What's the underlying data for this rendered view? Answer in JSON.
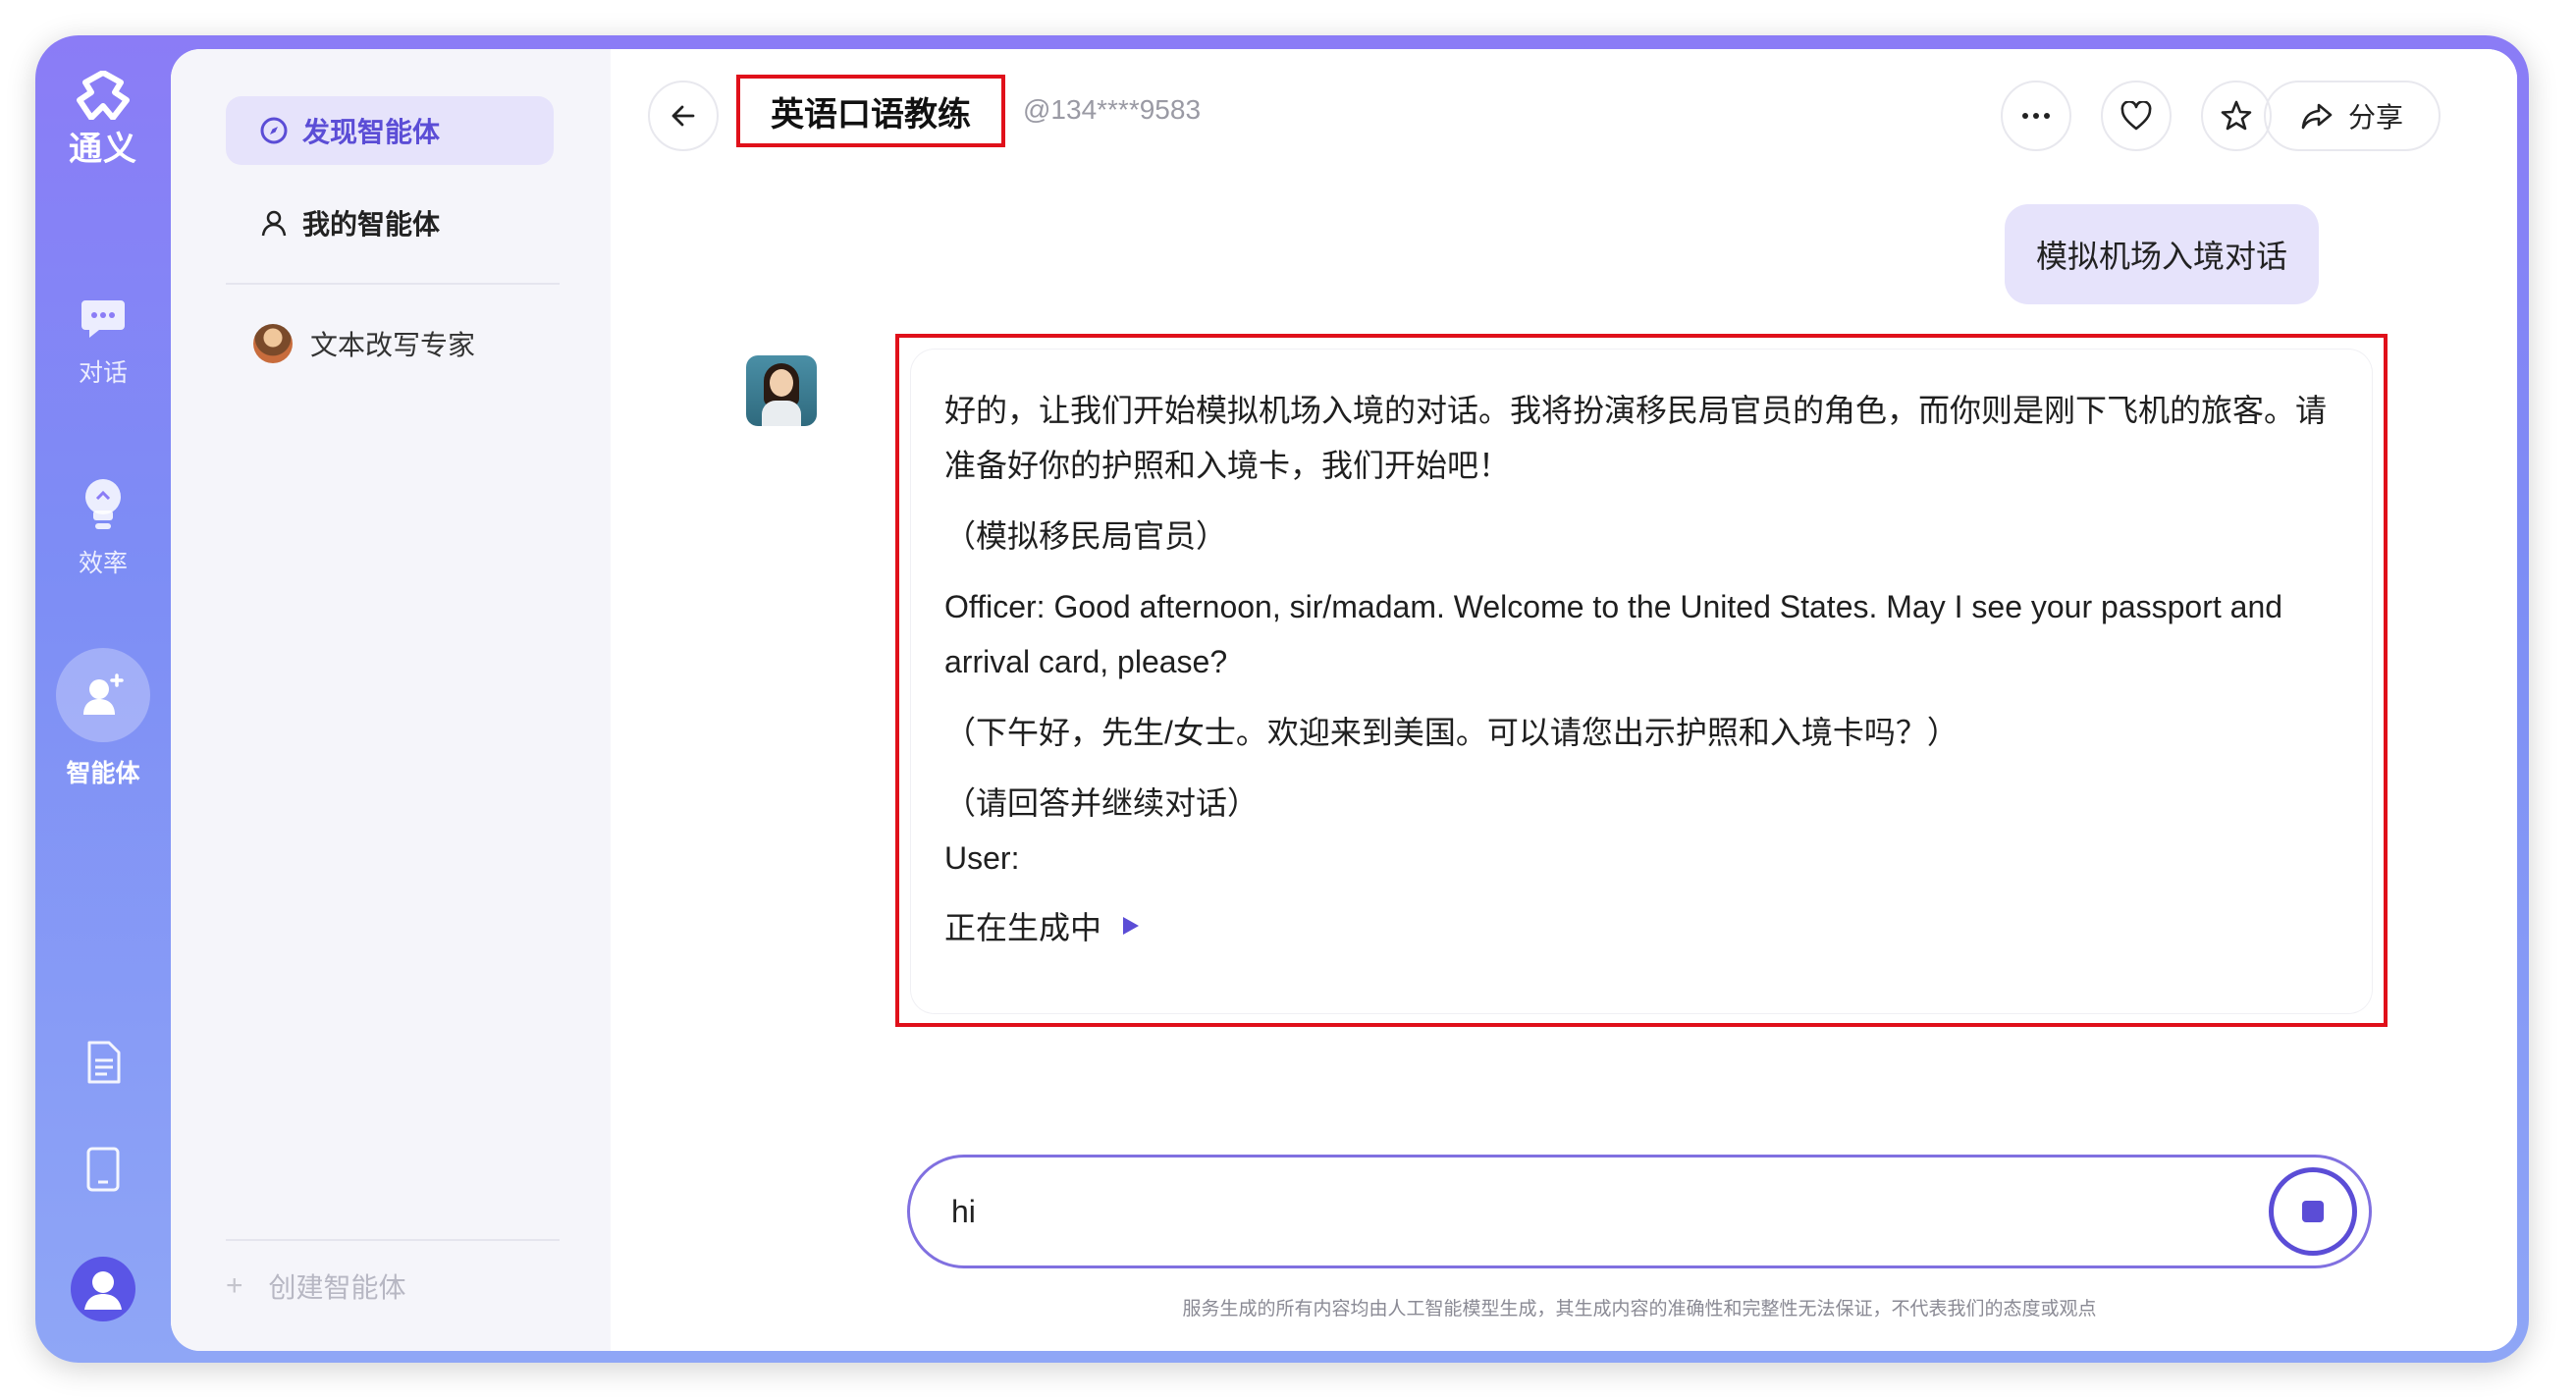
{
  "rail": {
    "logo_label": "通义",
    "items": [
      {
        "label": "对话",
        "icon": "chat-bubble-icon"
      },
      {
        "label": "效率",
        "icon": "lightbulb-icon"
      },
      {
        "label": "智能体",
        "icon": "agent-icon",
        "active": true
      }
    ],
    "bottom_icons": [
      "document-icon",
      "tablet-icon",
      "user-avatar-icon"
    ]
  },
  "sidebar": {
    "discover_label": "发现智能体",
    "mine_label": "我的智能体",
    "agents": [
      {
        "name": "文本改写专家"
      }
    ],
    "create_label": "创建智能体"
  },
  "header": {
    "title": "英语口语教练",
    "handle": "@134****9583",
    "share_label": "分享"
  },
  "messages": {
    "user": "模拟机场入境对话",
    "bot": {
      "p1": "好的，让我们开始模拟机场入境的对话。我将扮演移民局官员的角色，而你则是刚下飞机的旅客。请准备好你的护照和入境卡，我们开始吧！",
      "p2": "（模拟移民局官员）",
      "p3": "Officer: Good afternoon, sir/madam. Welcome to the United States. May I see your passport and arrival card, please?",
      "p4": "（下午好，先生/女士。欢迎来到美国。可以请您出示护照和入境卡吗？）",
      "p5": "（请回答并继续对话）",
      "p6": "User:",
      "generating": "正在生成中"
    }
  },
  "input": {
    "value": "hi"
  },
  "disclaimer": "服务生成的所有内容均由人工智能模型生成，其生成内容的准确性和完整性无法保证，不代表我们的态度或观点",
  "colors": {
    "accent": "#5b4dd6",
    "annotation_red": "#e0101a",
    "rail_gradient_top": "#8b7cf6"
  }
}
